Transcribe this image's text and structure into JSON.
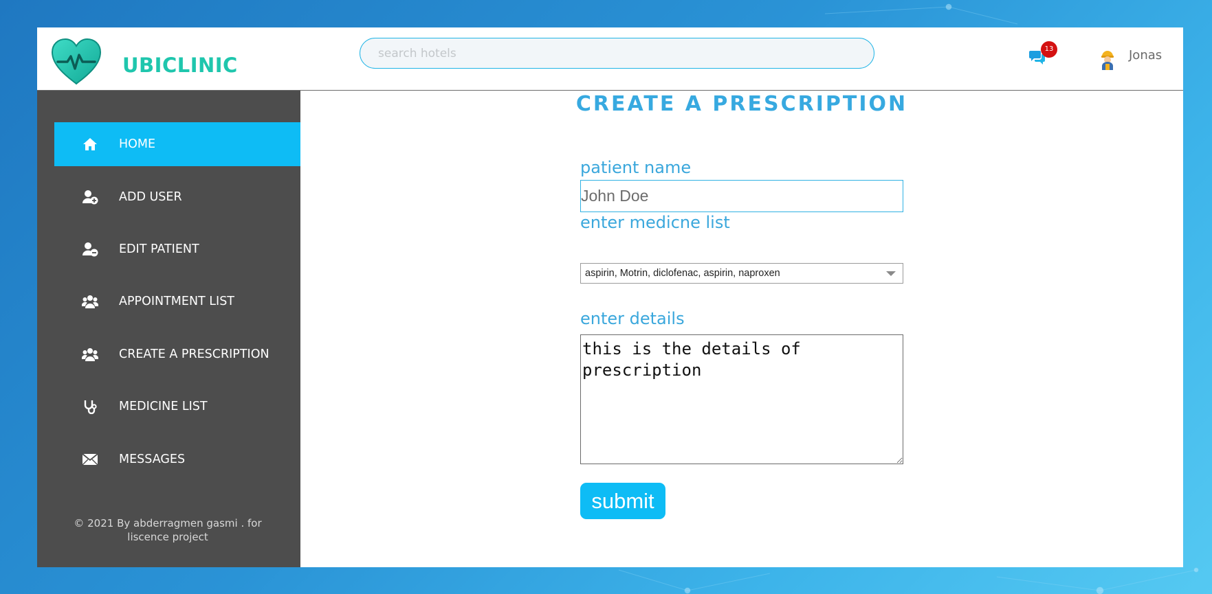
{
  "app": {
    "brand": "UBICLINIC",
    "logo_icon": "heart-pulse-icon",
    "accent_color": "#0ebcf5",
    "brand_color": "#1fc6ad"
  },
  "header": {
    "search_placeholder": "search hotels",
    "messages_icon": "chat-bubbles-icon",
    "notification_count": "13",
    "user_avatar_icon": "worker-avatar-icon",
    "user_name": "Jonas"
  },
  "sidebar": {
    "items": [
      {
        "label": "HOME",
        "icon": "home-icon",
        "active": true
      },
      {
        "label": "ADD USER",
        "icon": "user-plus-icon",
        "active": false
      },
      {
        "label": "EDIT PATIENT",
        "icon": "user-minus-icon",
        "active": false
      },
      {
        "label": "APPOINTMENT LIST",
        "icon": "users-icon",
        "active": false
      },
      {
        "label": "CREATE A PRESCRIPTION",
        "icon": "users-icon",
        "active": false
      },
      {
        "label": "MEDICINE LIST",
        "icon": "stethoscope-icon",
        "active": false
      },
      {
        "label": "MESSAGES",
        "icon": "envelope-icon",
        "active": false
      }
    ],
    "footer_line1": "© 2021 By abderragmen gasmi . for",
    "footer_line2": "liscence project"
  },
  "main": {
    "title": "CREATE A PRESCRIPTION",
    "patient_label": "patient name",
    "patient_value": "John Doe",
    "medicine_label": "enter medicne list",
    "medicine_value": "aspirin, Motrin, diclofenac, aspirin, naproxen",
    "details_label": "enter details",
    "details_value": "this is the details of prescription",
    "submit_label": "submit"
  }
}
